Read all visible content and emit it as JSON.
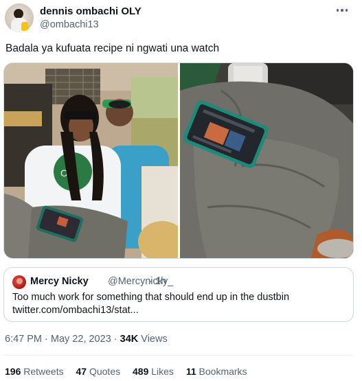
{
  "author": {
    "display_name": "dennis ombachi OLY",
    "handle": "@ombachi13",
    "avatar_icon": "profile-photo"
  },
  "more_icon": "ellipsis-icon",
  "tweet_text": "Badala ya kufuata recipe ni ngwati una watch",
  "media": {
    "photo_count": 2
  },
  "quoted_tweet": {
    "display_name": "Mercy Nicky",
    "handle": "@Mercynicky_",
    "separator": "·",
    "time": "1h",
    "text_line1": "Too much work for something that should end up in the dustbin",
    "text_line2": "twitter.com/ombachi13/stat..."
  },
  "meta": {
    "time": "6:47 PM",
    "sep1": " · ",
    "date": "May 22, 2023",
    "sep2": " · ",
    "views_count": "34K",
    "views_label": " Views"
  },
  "stats": [
    {
      "count": "196",
      "label": "Retweets"
    },
    {
      "count": "47",
      "label": "Quotes"
    },
    {
      "count": "489",
      "label": "Likes"
    },
    {
      "count": "11",
      "label": "Bookmarks"
    }
  ],
  "colors": {
    "text_primary": "#0f1419",
    "text_secondary": "#536471",
    "border": "#cfd9de"
  }
}
